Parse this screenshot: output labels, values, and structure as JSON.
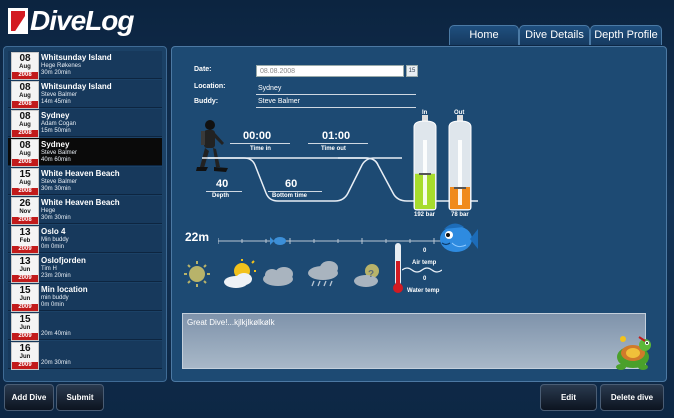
{
  "app": {
    "title": "DiveLog"
  },
  "tabs": [
    {
      "label": "Home"
    },
    {
      "label": "Dive Details"
    },
    {
      "label": "Depth Profile"
    }
  ],
  "dives": [
    {
      "day": "08",
      "month": "Aug",
      "year": "2008",
      "site": "Whitsunday Island",
      "buddy": "Hege Røkenes",
      "info": "30m 20min"
    },
    {
      "day": "08",
      "month": "Aug",
      "year": "2008",
      "site": "Whitsunday Island",
      "buddy": "Steve Balmer",
      "info": "14m 45min"
    },
    {
      "day": "08",
      "month": "Aug",
      "year": "2008",
      "site": "Sydney",
      "buddy": "Adam Cogan",
      "info": "15m 50min"
    },
    {
      "day": "08",
      "month": "Aug",
      "year": "2008",
      "site": "Sydney",
      "buddy": "Steve Balmer",
      "info": "40m 60min"
    },
    {
      "day": "15",
      "month": "Aug",
      "year": "2008",
      "site": "White Heaven Beach",
      "buddy": "Steve Balmer",
      "info": "30m 30min"
    },
    {
      "day": "26",
      "month": "Nov",
      "year": "2008",
      "site": "White Heaven Beach",
      "buddy": "Hege",
      "info": "30m 30min"
    },
    {
      "day": "13",
      "month": "Feb",
      "year": "2009",
      "site": "Oslo 4",
      "buddy": "Min buddy",
      "info": "0m 0min"
    },
    {
      "day": "13",
      "month": "Jun",
      "year": "2009",
      "site": "Oslofjorden",
      "buddy": "Tim H",
      "info": "23m 20min"
    },
    {
      "day": "15",
      "month": "Jun",
      "year": "2009",
      "site": "Min location",
      "buddy": "min buddy",
      "info": "0m 0min"
    },
    {
      "day": "15",
      "month": "Jun",
      "year": "2009",
      "site": "",
      "buddy": "",
      "info": "20m 40min"
    },
    {
      "day": "16",
      "month": "Jun",
      "year": "2009",
      "site": "",
      "buddy": "",
      "info": "20m 30min"
    }
  ],
  "details": {
    "date_label": "Date:",
    "date_value": "08.08.2008",
    "calendar_glyph": "15",
    "location_label": "Location:",
    "location_value": "Sydney",
    "buddy_label": "Buddy:",
    "buddy_value": "Steve Balmer",
    "time_in": "00:00",
    "time_in_label": "Time in",
    "time_out": "01:00",
    "time_out_label": "Time out",
    "depth": "40",
    "depth_label": "Depth",
    "bottom_time": "60",
    "bottom_time_label": "Bottom time",
    "tank_in_label": "In",
    "tank_in_bar": "192 bar",
    "tank_in_level": 0.4,
    "tank_out_label": "Out",
    "tank_out_bar": "78 bar",
    "tank_out_level": 0.25,
    "visibility": "22m",
    "air_temp": "0",
    "air_temp_label": "Air temp",
    "water_temp": "0",
    "water_temp_label": "Water temp",
    "notes": "Great Dive!...kjlkjlkølkølk"
  },
  "buttons": {
    "add": "Add Dive",
    "submit": "Submit",
    "edit": "Edit",
    "delete": "Delete dive"
  },
  "colors": {
    "tank_in": "#a7dc2c",
    "tank_out": "#f08a1c",
    "year_badge": "#c21b1b",
    "selected_row": "#0a0a0a"
  }
}
